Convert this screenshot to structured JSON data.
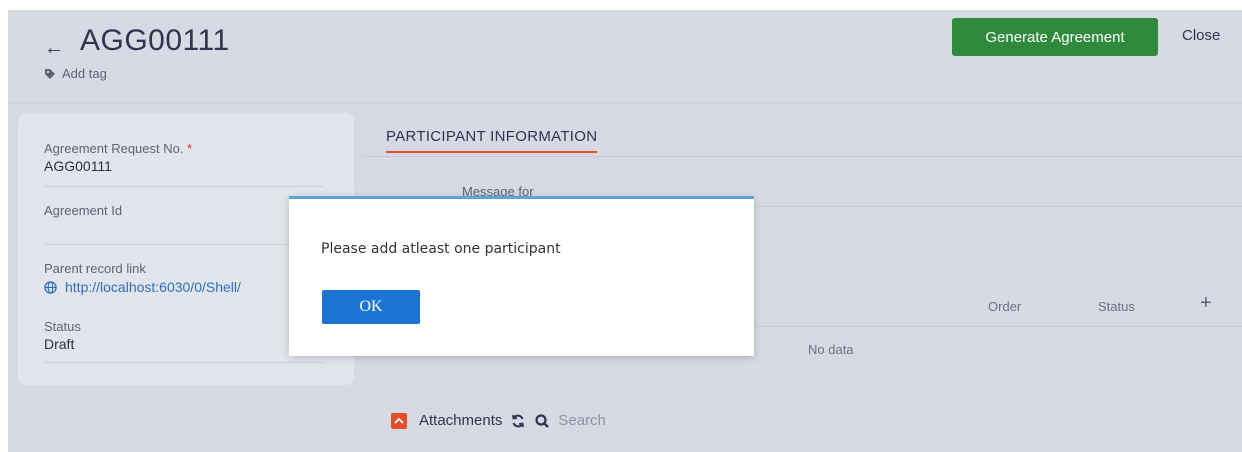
{
  "header": {
    "title": "AGG00111",
    "add_tag_label": "Add tag",
    "generate_button": "Generate Agreement",
    "close_label": "Close"
  },
  "left_panel": {
    "fields": [
      {
        "label": "Agreement Request No.",
        "required_mark": "*",
        "value": "AGG00111"
      },
      {
        "label": "Agreement Id",
        "value": ""
      },
      {
        "label": "Parent record link",
        "value": "http://localhost:6030/0/Shell/"
      },
      {
        "label": "Status",
        "value": "Draft"
      }
    ]
  },
  "tabs": [
    {
      "label": "PARTICIPANT INFORMATION",
      "active": true
    }
  ],
  "participant_section": {
    "message_for_label": "Message for",
    "columns": [
      "Order",
      "Status"
    ],
    "empty_text": "No data"
  },
  "attachments": {
    "title": "Attachments",
    "search_placeholder": "Search"
  },
  "modal": {
    "message": "Please add atleast one participant",
    "ok_label": "OK"
  },
  "colors": {
    "primary_button": "#2f8a3d",
    "accent": "#e0502b",
    "ok_button": "#1a75d2",
    "link": "#2c6fb7"
  },
  "icons": [
    "back-arrow-icon",
    "tag-icon",
    "globe-icon",
    "plus-icon",
    "chevron-up-icon",
    "refresh-icon",
    "search-icon"
  ]
}
